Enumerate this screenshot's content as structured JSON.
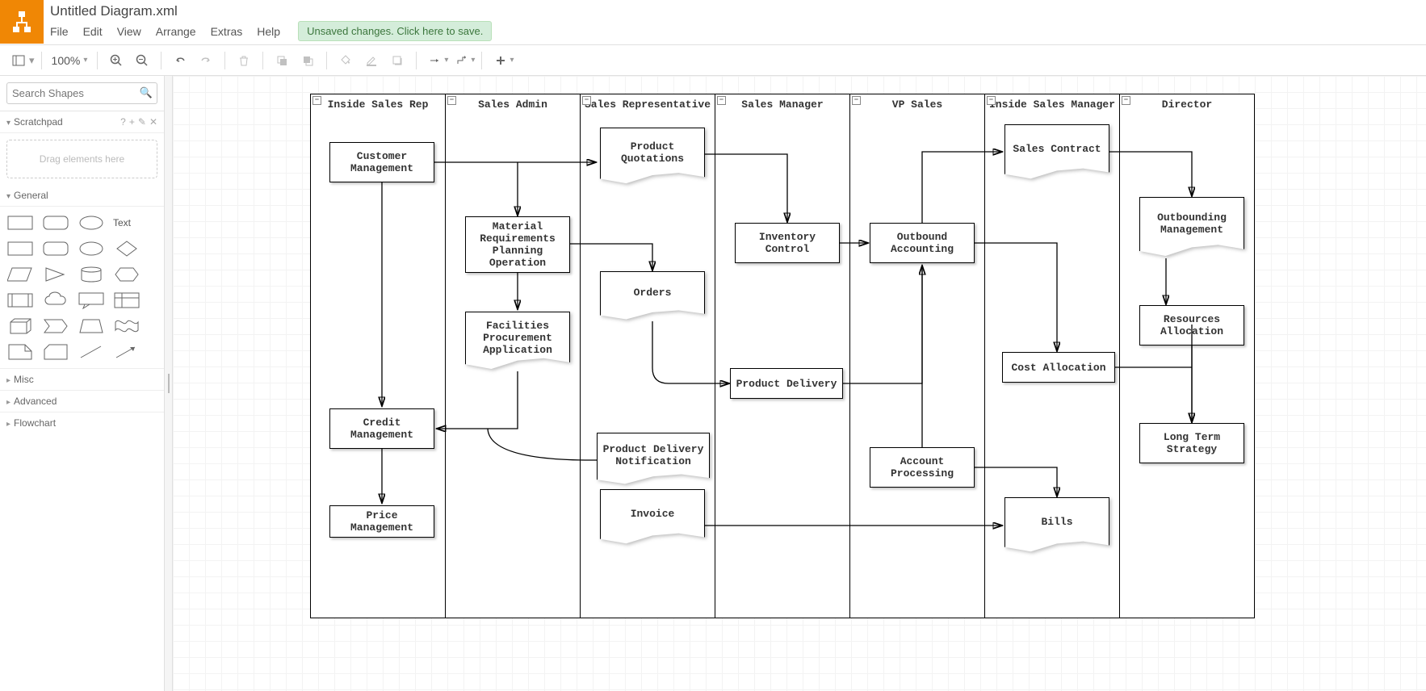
{
  "app": {
    "title": "Untitled Diagram.xml",
    "save_message": "Unsaved changes. Click here to save."
  },
  "menu": {
    "file": "File",
    "edit": "Edit",
    "view": "View",
    "arrange": "Arrange",
    "extras": "Extras",
    "help": "Help"
  },
  "toolbar": {
    "zoom": "100%"
  },
  "sidebar": {
    "search_placeholder": "Search Shapes",
    "scratchpad_label": "Scratchpad",
    "scratchpad_help": "?",
    "drag_hint": "Drag elements here",
    "general_label": "General",
    "text_label": "Text",
    "categories": {
      "misc": "Misc",
      "advanced": "Advanced",
      "flowchart": "Flowchart"
    }
  },
  "lanes": [
    {
      "title": "Inside Sales Rep"
    },
    {
      "title": "Sales Admin"
    },
    {
      "title": "Sales Representative"
    },
    {
      "title": "Sales Manager"
    },
    {
      "title": "VP Sales"
    },
    {
      "title": "Inside Sales Manager"
    },
    {
      "title": "Director"
    }
  ],
  "nodes": {
    "customer_mgmt": "Customer Management",
    "credit_mgmt": "Credit Management",
    "price_mgmt": "Price Management",
    "material_req": "Material Requirements Planning Operation",
    "facilities_proc": "Facilities Procurement Application",
    "product_quot": "Product Quotations",
    "orders": "Orders",
    "product_deliv_notif": "Product Delivery Notification",
    "invoice": "Invoice",
    "inventory_ctrl": "Inventory Control",
    "product_delivery": "Product Delivery",
    "outbound_acct": "Outbound Accounting",
    "account_proc": "Account Processing",
    "sales_contract": "Sales Contract",
    "cost_alloc": "Cost Allocation",
    "bills": "Bills",
    "outbounding_mgmt": "Outbounding Management",
    "resources_alloc": "Resources Allocation",
    "long_term_strat": "Long Term Strategy"
  }
}
